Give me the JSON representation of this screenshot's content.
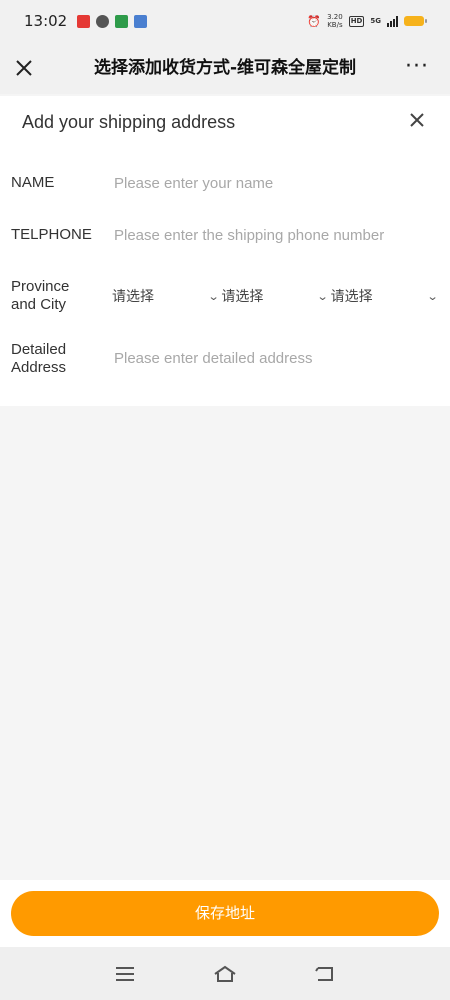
{
  "status_bar": {
    "time": "13:02",
    "network_speed": "3.20",
    "network_unit": "KB/s",
    "hd_label": "HD",
    "signal_label": "5G"
  },
  "title_bar": {
    "close_icon": "close-icon",
    "title": "选择添加收货方式-维可森全屋定制",
    "more_label": "···"
  },
  "form": {
    "heading": "Add your shipping address",
    "close_symbol": "✕",
    "name_label": "NAME",
    "name_placeholder": "Please enter your name",
    "phone_label": "TELPHONE",
    "phone_placeholder": "Please enter the shipping phone number",
    "region_label_line1": "Province",
    "region_label_line2": "and City",
    "selects": [
      "请选择",
      "请选择",
      "请选择"
    ],
    "address_label_line1": "Detailed",
    "address_label_line2": "Address",
    "address_placeholder": "Please enter detailed address"
  },
  "footer": {
    "save_label": "保存地址"
  },
  "colors": {
    "accent": "#ff9a00",
    "page_bg": "#f5f5f5",
    "card_bg": "#ffffff"
  }
}
